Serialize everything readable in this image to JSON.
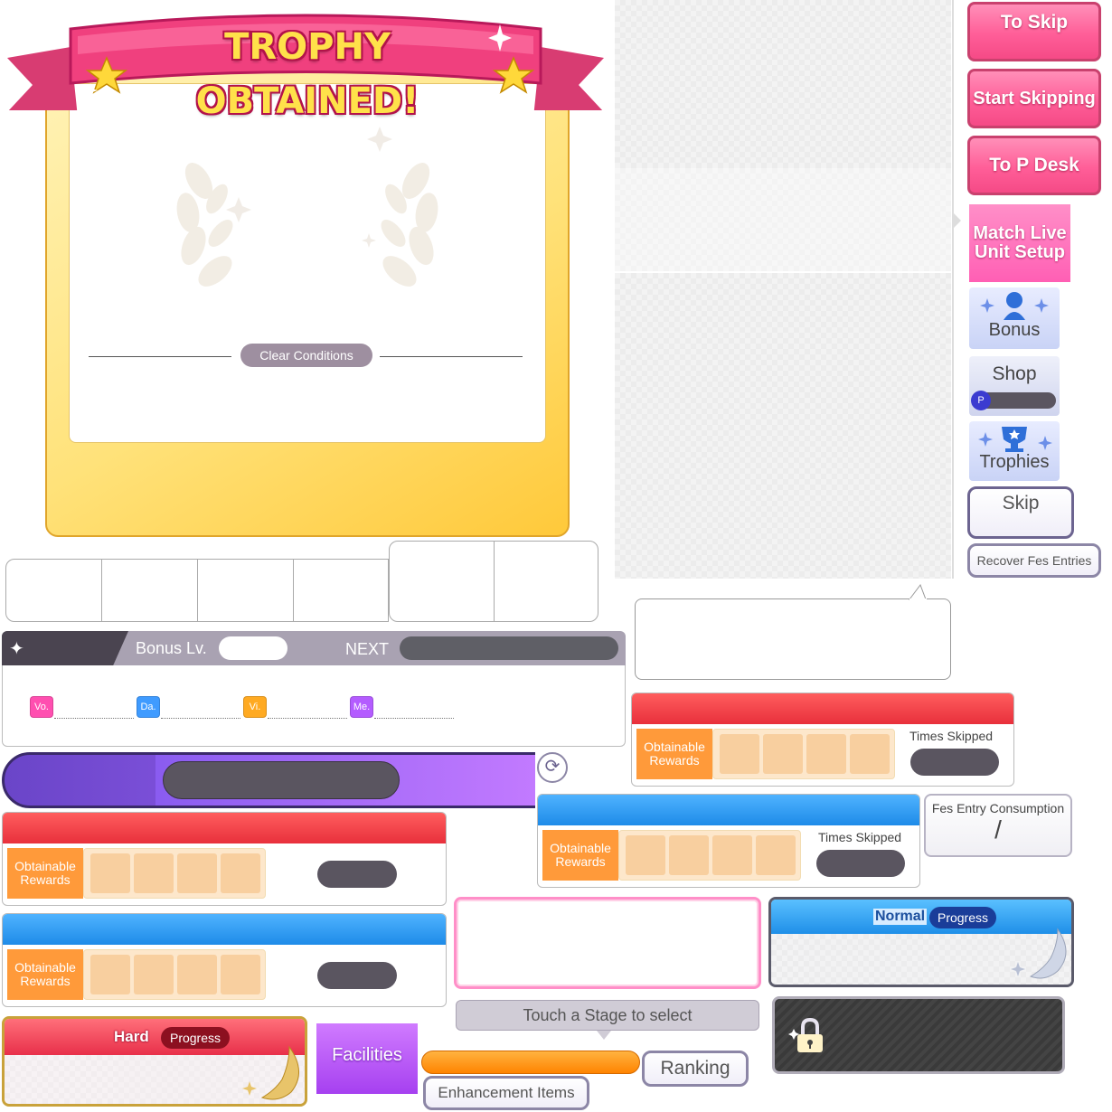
{
  "trophy": {
    "banner_title": "TROPHY OBTAINED!",
    "clear_conditions_label": "Clear Conditions"
  },
  "buttons": {
    "to_skip": "To Skip",
    "start_skipping": "Start Skipping",
    "to_p_desk": "To P Desk",
    "match_live_line1": "Match Live",
    "match_live_line2": "Unit Setup",
    "bonus": "Bonus",
    "shop": "Shop",
    "trophies": "Trophies",
    "skip": "Skip",
    "recover_fes_entries": "Recover Fes Entries",
    "facilities": "Facilities",
    "ranking": "Ranking",
    "enhancement_items": "Enhancement Items"
  },
  "bonus_bar": {
    "label": "Bonus Lv.",
    "next_label": "NEXT",
    "stats": [
      "Vo.",
      "Da.",
      "Vi.",
      "Me."
    ]
  },
  "rewards": {
    "obtainable_line1": "Obtainable",
    "obtainable_line2": "Rewards",
    "times_skipped": "Times Skipped",
    "fes_entry_consumption": "Fes Entry Consumption",
    "fes_entry_slash": "/"
  },
  "stage": {
    "touch_stage": "Touch a Stage to select",
    "normal_label": "Normal",
    "hard_label": "Hard",
    "progress_label": "Progress"
  },
  "colors": {
    "pink": "#ff5e98",
    "vo": "#ff4fb0",
    "da": "#3f9bff",
    "vi": "#ffaa22",
    "me": "#b45cff"
  }
}
